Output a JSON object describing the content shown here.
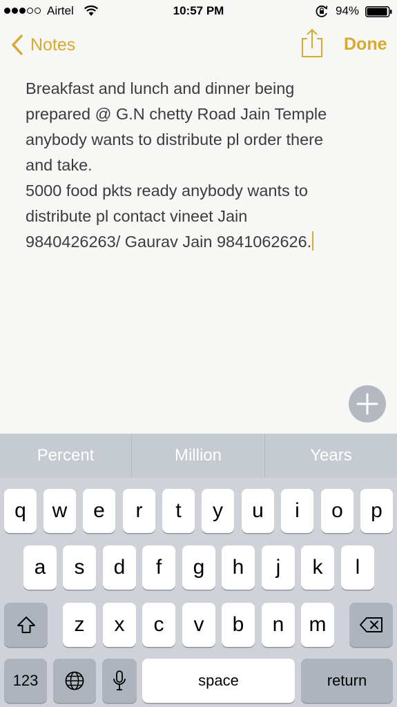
{
  "status_bar": {
    "carrier": "Airtel",
    "time": "10:57 PM",
    "battery": "94%",
    "signal_bars_filled": 3,
    "signal_bars_total": 5,
    "battery_level": 0.94
  },
  "nav": {
    "back_label": "Notes",
    "done_label": "Done",
    "accent_color": "#d7a92f"
  },
  "note": {
    "lines": [
      "Breakfast and lunch and dinner being",
      "prepared @ G.N chetty Road Jain Temple",
      "anybody wants to distribute pl order there",
      "and take.",
      "5000 food pkts ready anybody wants to",
      "distribute pl contact vineet Jain",
      "9840426263/ Gaurav Jain 9841062626."
    ]
  },
  "keyboard": {
    "suggestions": [
      "Percent",
      "Million",
      "Years"
    ],
    "row1": [
      "q",
      "w",
      "e",
      "r",
      "t",
      "y",
      "u",
      "i",
      "o",
      "p"
    ],
    "row2": [
      "a",
      "s",
      "d",
      "f",
      "g",
      "h",
      "j",
      "k",
      "l"
    ],
    "row3": [
      "z",
      "x",
      "c",
      "v",
      "b",
      "n",
      "m"
    ],
    "numbers_label": "123",
    "space_label": "space",
    "return_label": "return",
    "icons": {
      "shift": "shift-arrow-icon",
      "delete": "backspace-icon",
      "globe": "globe-icon",
      "mic": "microphone-icon",
      "add": "plus-icon",
      "share": "share-icon"
    }
  }
}
